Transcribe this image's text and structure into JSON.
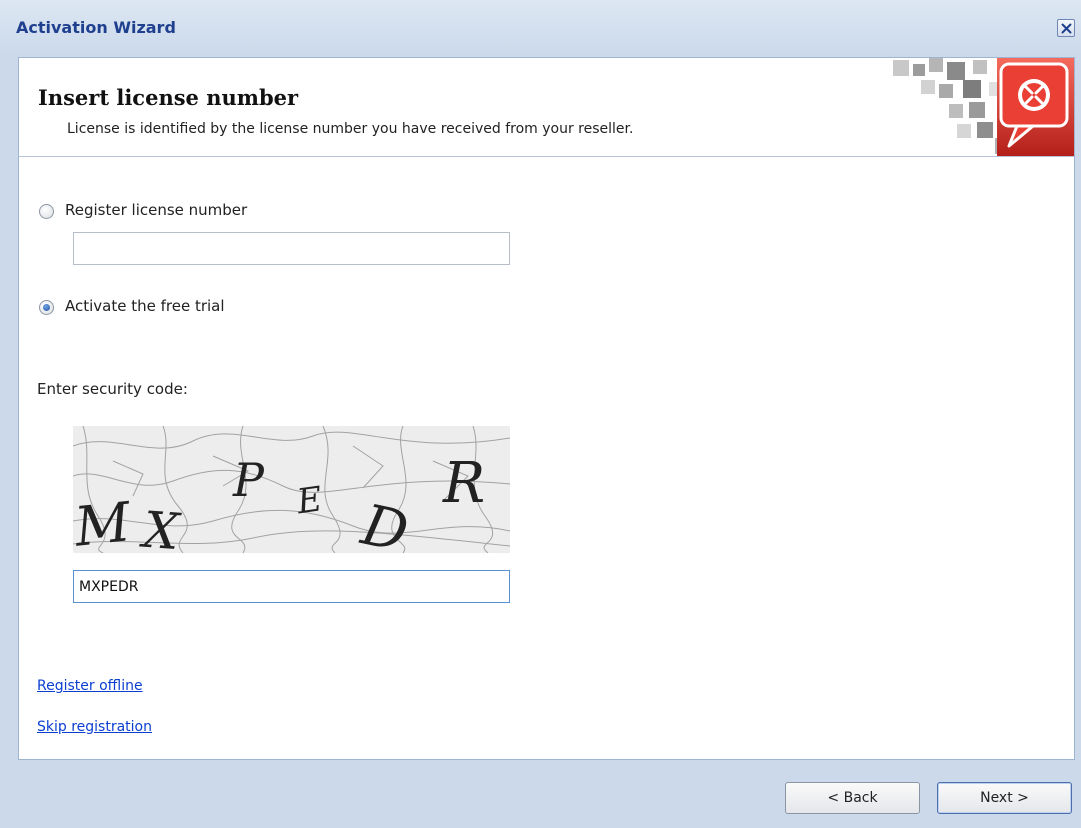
{
  "window": {
    "title": "Activation Wizard"
  },
  "header": {
    "title": "Insert license number",
    "subtitle": "License is identified by the license number you have received from your reseller."
  },
  "options": {
    "register_label": "Register license number",
    "register_value": "",
    "register_checked": false,
    "trial_label": "Activate the free trial",
    "trial_checked": true
  },
  "security": {
    "label": "Enter security code:",
    "captcha_letters": [
      "M",
      "X",
      "P",
      "E",
      "D",
      "R"
    ],
    "code_value": "MXPEDR"
  },
  "links": {
    "register_offline": "Register offline",
    "skip_registration": "Skip registration"
  },
  "buttons": {
    "back": "< Back",
    "next": "Next >"
  },
  "colors": {
    "titlebar": "#cbd9ea",
    "title_text": "#1f3f8f",
    "link": "#0b3fd1",
    "logo_red": "#d9302b"
  },
  "icons": {
    "close": "close-icon",
    "logo": "logo-icon"
  }
}
